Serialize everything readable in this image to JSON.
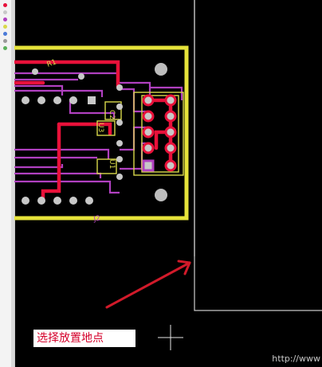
{
  "status": {
    "text": "选择放置地点"
  },
  "components": {
    "r1_label": "R1",
    "c2_label": "C2",
    "u3_label": "U3",
    "u1_label": "U1",
    "j2_label": "J2"
  },
  "watermark": {
    "text": "http://www"
  },
  "colors": {
    "background": "#000000",
    "board_outline": "#e6e33a",
    "top_trace": "#e8113a",
    "bottom_trace": "#b040c0",
    "pad": "#c8c8c8",
    "silkscreen": "#d8d84a",
    "selection_box": "#cfcfcf",
    "annotation_arrow": "#d11a2a",
    "status_text": "#d4002a"
  },
  "icons": [
    "crosshair-cursor-icon",
    "annotation-arrow-icon",
    "layer-color-dots-icon"
  ]
}
